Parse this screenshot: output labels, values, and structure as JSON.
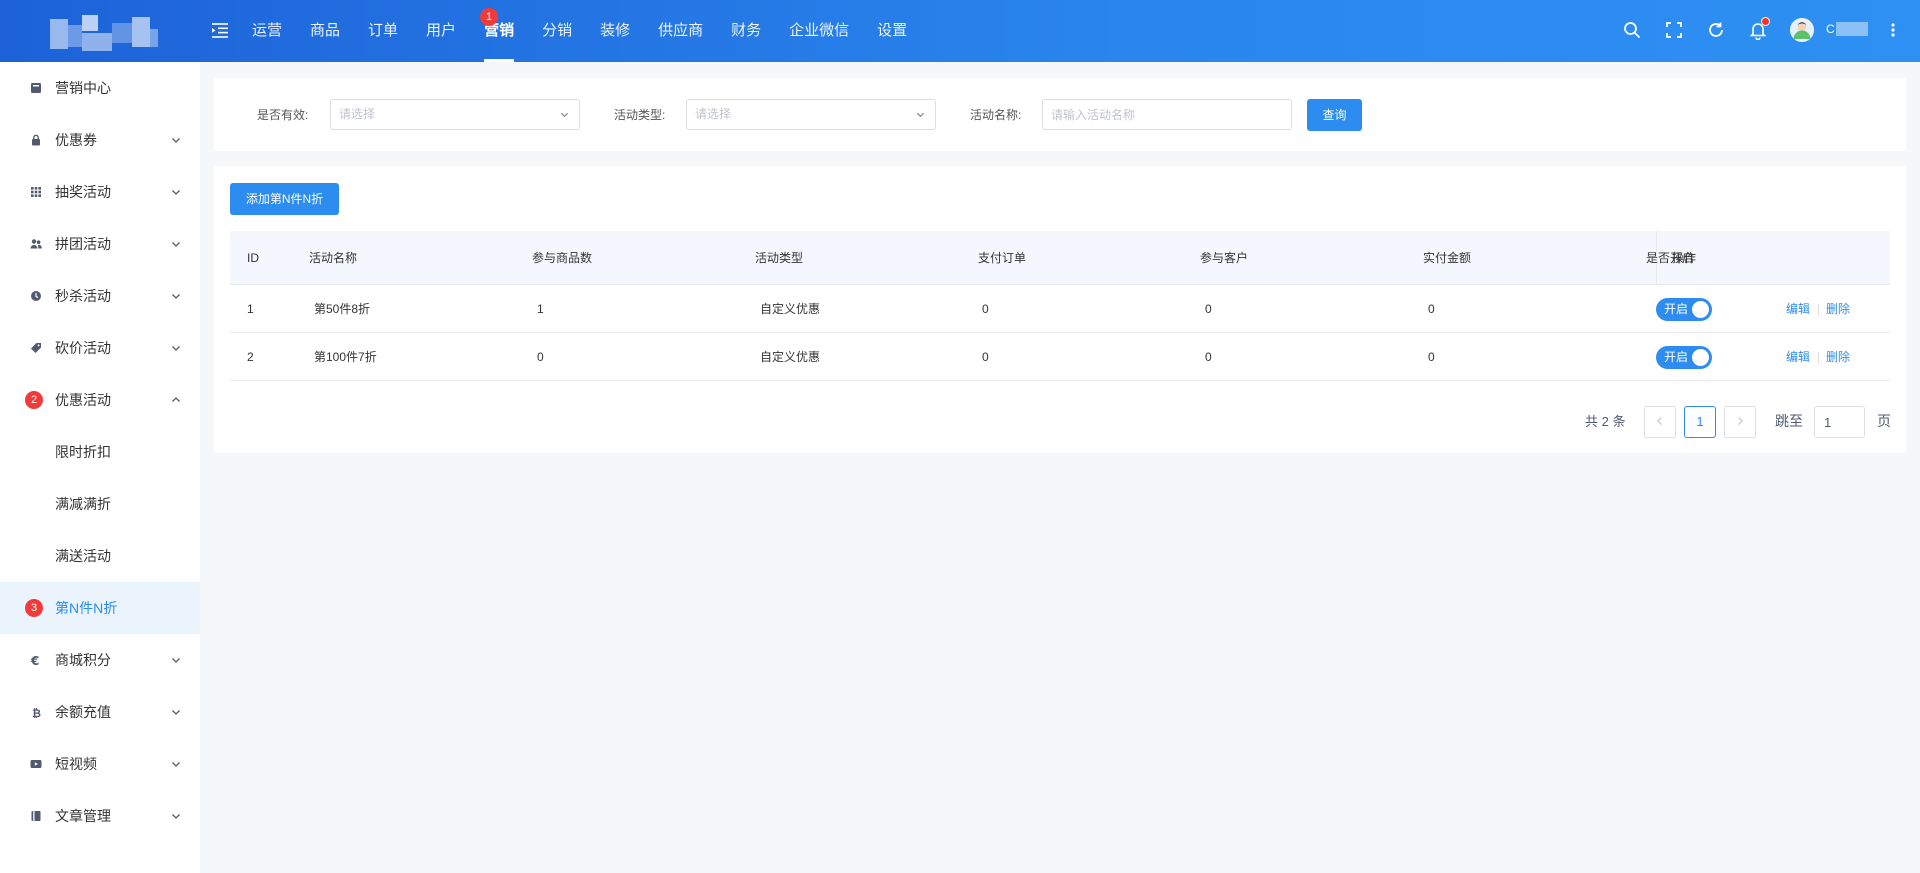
{
  "header": {
    "nav": [
      "运营",
      "商品",
      "订单",
      "用户",
      "营销",
      "分销",
      "装修",
      "供应商",
      "财务",
      "企业微信",
      "设置"
    ],
    "active_nav": "营销",
    "nav_badge": "1",
    "username": "C"
  },
  "sidebar": {
    "items": [
      {
        "label": "营销中心",
        "icon": "dashboard-icon"
      },
      {
        "label": "优惠券",
        "icon": "lock-icon"
      },
      {
        "label": "抽奖活动",
        "icon": "grid-icon"
      },
      {
        "label": "拼团活动",
        "icon": "users-icon"
      },
      {
        "label": "秒杀活动",
        "icon": "clock-icon"
      },
      {
        "label": "砍价活动",
        "icon": "tag-icon"
      },
      {
        "label": "优惠活动",
        "badge": "2"
      },
      {
        "label": "限时折扣",
        "sub": true
      },
      {
        "label": "满减满折",
        "sub": true
      },
      {
        "label": "满送活动",
        "sub": true
      },
      {
        "label": "第N件N折",
        "sub": true,
        "active": true,
        "badge": "3"
      },
      {
        "label": "商城积分",
        "icon": "euro-icon"
      },
      {
        "label": "余额充值",
        "icon": "bitcoin-icon"
      },
      {
        "label": "短视频",
        "icon": "video-icon"
      },
      {
        "label": "文章管理",
        "icon": "book-icon"
      }
    ]
  },
  "filter": {
    "valid_label": "是否有效:",
    "valid_placeholder": "请选择",
    "type_label": "活动类型:",
    "type_placeholder": "请选择",
    "name_label": "活动名称:",
    "name_placeholder": "请输入活动名称",
    "search_button": "查询"
  },
  "table": {
    "add_button": "添加第N件N折",
    "columns": [
      "ID",
      "活动名称",
      "参与商品数",
      "活动类型",
      "支付订单",
      "参与客户",
      "实付金额",
      "是否开启",
      "操作"
    ],
    "rows": [
      {
        "id": "1",
        "name": "第50件8折",
        "goods": "1",
        "type": "自定义优惠",
        "orders": "0",
        "customers": "0",
        "amount": "0",
        "switch": "开启"
      },
      {
        "id": "2",
        "name": "第100件7折",
        "goods": "0",
        "type": "自定义优惠",
        "orders": "0",
        "customers": "0",
        "amount": "0",
        "switch": "开启"
      }
    ],
    "edit_label": "编辑",
    "delete_label": "删除"
  },
  "pagination": {
    "total": "共 2 条",
    "current": "1",
    "jump_label": "跳至",
    "jump_value": "1",
    "page_suffix": "页"
  }
}
